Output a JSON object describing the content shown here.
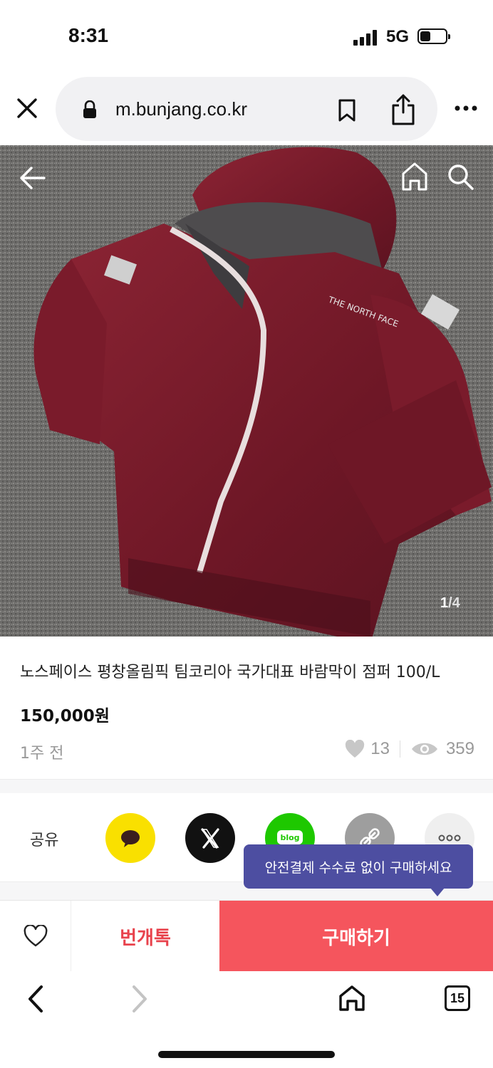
{
  "status_bar": {
    "time": "8:31",
    "network": "5G",
    "battery_level": 0.4
  },
  "browser": {
    "url": "m.bunjang.co.kr"
  },
  "product_image": {
    "counter_current": "1",
    "counter_total": "/4"
  },
  "product": {
    "title": "노스페이스 평창올림픽 팀코리아 국가대표 바람막이 점퍼 100/L",
    "price": "150,000원",
    "time_ago": "1주 전",
    "likes": "13",
    "views": "359"
  },
  "share": {
    "label": "공유",
    "blog_text": "blog",
    "tooltip": "안전결제 수수료 없이 구매하세요"
  },
  "actions": {
    "chat_label": "번개톡",
    "buy_label": "구매하기"
  },
  "bottom_nav": {
    "tab_count": "15"
  },
  "colors": {
    "accent": "#f5555d",
    "chat_text": "#e8424c",
    "tooltip_bg": "#4d4ea1",
    "kakao": "#f9e000",
    "naver_blog": "#1ec800"
  },
  "icons": [
    "close-icon",
    "lock-icon",
    "bookmark-icon",
    "share-icon",
    "more-icon",
    "back-arrow-icon",
    "home-icon",
    "search-icon",
    "heart-icon",
    "eye-icon",
    "kakao-icon",
    "x-icon",
    "blog-icon",
    "link-icon",
    "more-dots-icon",
    "chevron-left-icon",
    "chevron-right-icon",
    "tabs-icon"
  ]
}
